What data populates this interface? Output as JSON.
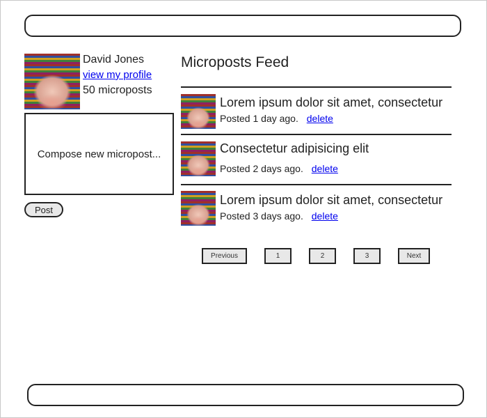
{
  "user": {
    "name": "David Jones",
    "profile_link": "view my profile",
    "post_count": "50 microposts"
  },
  "compose": {
    "placeholder": "Compose new micropost...",
    "post_label": "Post"
  },
  "feed": {
    "title": "Microposts Feed",
    "items": [
      {
        "text": "Lorem ipsum dolor sit amet, consectetur",
        "meta": "Posted 1 day ago.",
        "delete_label": "delete"
      },
      {
        "text": "Consectetur adipisicing elit",
        "meta": "Posted 2 days ago.",
        "delete_label": "delete"
      },
      {
        "text": "Lorem ipsum dolor sit amet, consectetur",
        "meta": "Posted 3 days ago.",
        "delete_label": "delete"
      }
    ]
  },
  "pagination": {
    "previous": "Previous",
    "pages": [
      "1",
      "2",
      "3"
    ],
    "next": "Next"
  }
}
